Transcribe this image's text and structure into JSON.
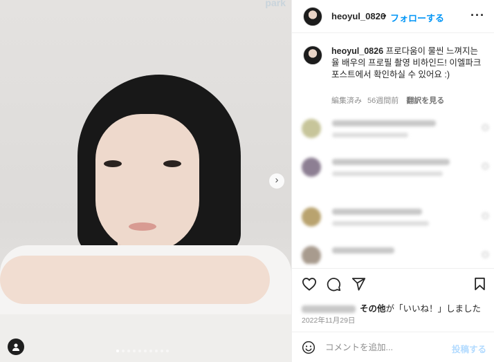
{
  "photo": {
    "watermark": "park",
    "next_icon": "chevron-right-icon",
    "tag_icon": "user-tag-icon",
    "carousel_dots": 10,
    "active_dot": 0
  },
  "header": {
    "username": "heoyul_0826",
    "separator": "•",
    "follow_label": "フォローする",
    "more_icon": "more-horizontal-icon",
    "more_label": "···"
  },
  "caption": {
    "username": "heoyul_0826",
    "text": "프로다움이 물씬 느껴지는 율 배우의 프로필 촬영 비하인드! 이엘파크 포스트에서 확인하실 수 있어요 :)",
    "edited": "編集済み",
    "time": "56週間前",
    "translate": "翻訳を見る"
  },
  "comments": [
    {
      "blurred": true,
      "avatar_color": "#c7c59a"
    },
    {
      "blurred": true,
      "avatar_color": "#8d7f93"
    },
    {
      "blurred": true,
      "avatar_color": "#b9a36f"
    },
    {
      "blurred": true,
      "avatar_color": "#a89b8e"
    }
  ],
  "actions": {
    "like_icon": "heart-icon",
    "comment_icon": "comment-icon",
    "share_icon": "send-icon",
    "save_icon": "bookmark-icon"
  },
  "likes": {
    "others": "その他",
    "suffix": "が「いいね！」しました"
  },
  "date": "2022年11月29日",
  "comment_box": {
    "emoji_icon": "smiley-icon",
    "placeholder": "コメントを追加...",
    "post_label": "投稿する"
  }
}
